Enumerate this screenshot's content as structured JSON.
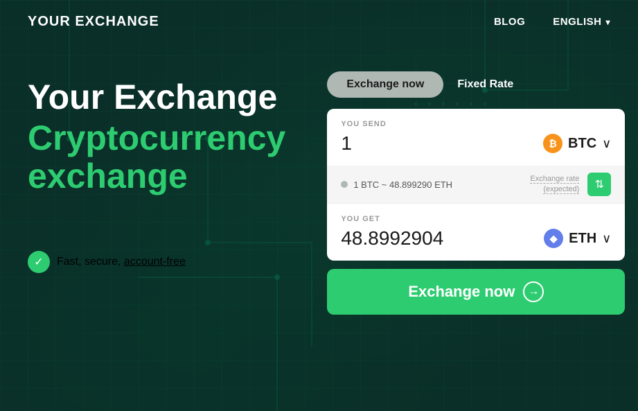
{
  "header": {
    "logo": "YOUR EXCHANGE",
    "nav": {
      "blog_label": "BLOG",
      "lang_label": "ENGLISH",
      "lang_chevron": "▾"
    }
  },
  "hero": {
    "title_line1": "Your Exchange",
    "title_line2": "Cryptocurrency",
    "title_line3": "exchange",
    "badge_text": "Fast, secure, ",
    "badge_link": "account-free"
  },
  "widget": {
    "tab_active": "Exchange now",
    "tab_inactive": "Fixed Rate",
    "send_label": "YOU SEND",
    "send_value": "1",
    "send_currency": "BTC",
    "send_currency_icon": "₿",
    "rate_conversion": "1 BTC ~ 48.899290 ETH",
    "rate_label": "Exchange rate",
    "rate_sublabel": "(expected)",
    "get_label": "YOU GET",
    "get_value": "48.8992904",
    "get_currency": "ETH",
    "get_currency_icon": "◆",
    "exchange_btn_label": "Exchange now",
    "swap_icon": "⇅"
  }
}
